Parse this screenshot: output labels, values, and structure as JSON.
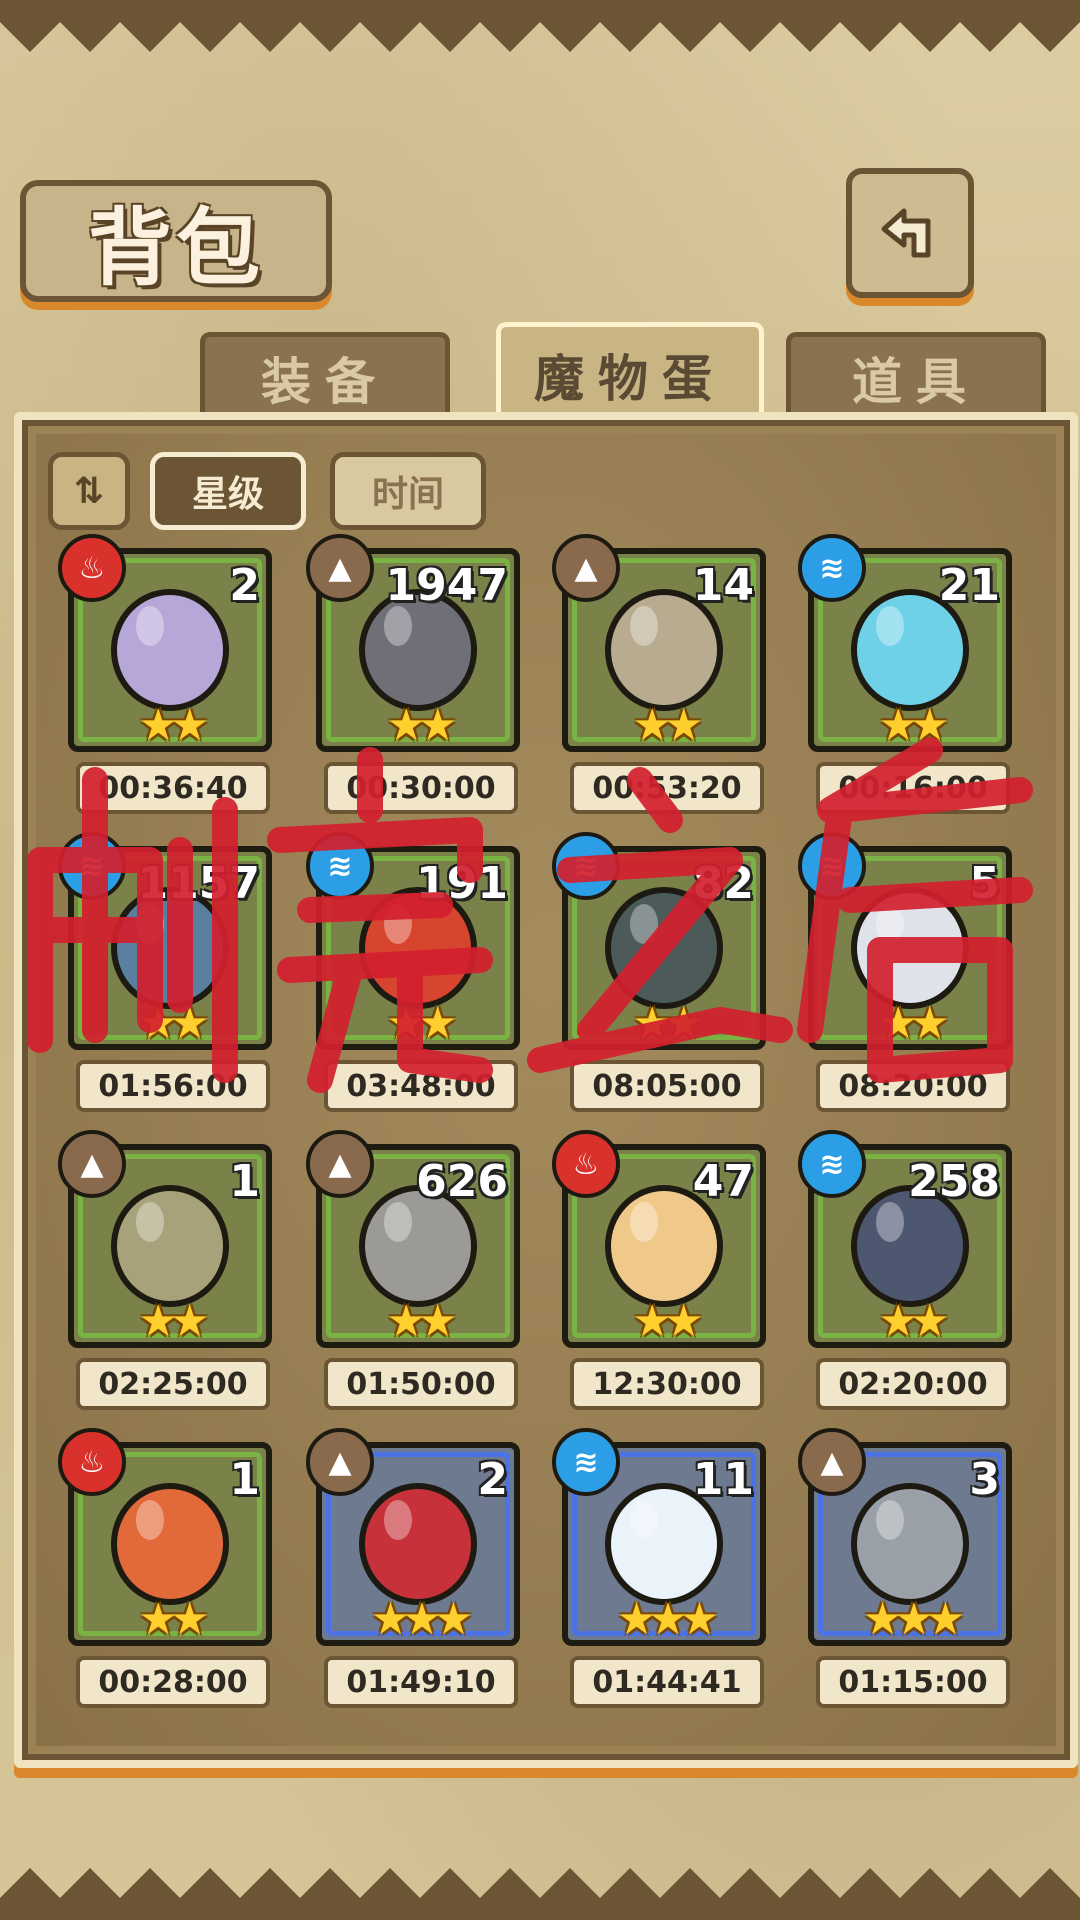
{
  "title": "背包",
  "tabs": [
    {
      "label": "装备",
      "active": false
    },
    {
      "label": "魔物蛋",
      "active": true
    },
    {
      "label": "道具",
      "active": false
    }
  ],
  "sort_buttons": {
    "sort_order": "⇅",
    "star": "星级",
    "time": "时间"
  },
  "overlay_text": "刷完之后",
  "eggs": [
    {
      "count": "2",
      "element": "fire",
      "stars": 2,
      "timer": "00:36:40",
      "egg_color": "#b7a6d8",
      "frame": "green"
    },
    {
      "count": "1947",
      "element": "earth",
      "stars": 2,
      "timer": "00:30:00",
      "egg_color": "#6f6f78",
      "frame": "green"
    },
    {
      "count": "14",
      "element": "earth",
      "stars": 2,
      "timer": "00:53:20",
      "egg_color": "#b8ab90",
      "frame": "green"
    },
    {
      "count": "21",
      "element": "water",
      "stars": 2,
      "timer": "00:16:00",
      "egg_color": "#6fd1e8",
      "frame": "green"
    },
    {
      "count": "1157",
      "element": "water",
      "stars": 2,
      "timer": "01:56:00",
      "egg_color": "#5a7fa0",
      "frame": "green"
    },
    {
      "count": "191",
      "element": "water",
      "stars": 2,
      "timer": "03:48:00",
      "egg_color": "#d8452e",
      "frame": "green"
    },
    {
      "count": "82",
      "element": "water",
      "stars": 2,
      "timer": "08:05:00",
      "egg_color": "#4c5a5a",
      "frame": "green"
    },
    {
      "count": "5",
      "element": "water",
      "stars": 2,
      "timer": "08:20:00",
      "egg_color": "#e0e2ea",
      "frame": "green"
    },
    {
      "count": "1",
      "element": "earth",
      "stars": 2,
      "timer": "02:25:00",
      "egg_color": "#a8a27a",
      "frame": "green"
    },
    {
      "count": "626",
      "element": "earth",
      "stars": 2,
      "timer": "01:50:00",
      "egg_color": "#9b9a96",
      "frame": "green"
    },
    {
      "count": "47",
      "element": "fire",
      "stars": 2,
      "timer": "12:30:00",
      "egg_color": "#f0c98a",
      "frame": "green"
    },
    {
      "count": "258",
      "element": "water",
      "stars": 2,
      "timer": "02:20:00",
      "egg_color": "#4e5770",
      "frame": "green"
    },
    {
      "count": "1",
      "element": "fire",
      "stars": 2,
      "timer": "00:28:00",
      "egg_color": "#e26a3a",
      "frame": "green"
    },
    {
      "count": "2",
      "element": "earth",
      "stars": 3,
      "timer": "01:49:10",
      "egg_color": "#c7323a",
      "frame": "blue"
    },
    {
      "count": "11",
      "element": "water",
      "stars": 3,
      "timer": "01:44:41",
      "egg_color": "#eaf2fa",
      "frame": "blue"
    },
    {
      "count": "3",
      "element": "earth",
      "stars": 3,
      "timer": "01:15:00",
      "egg_color": "#9aa0a8",
      "frame": "blue"
    }
  ]
}
